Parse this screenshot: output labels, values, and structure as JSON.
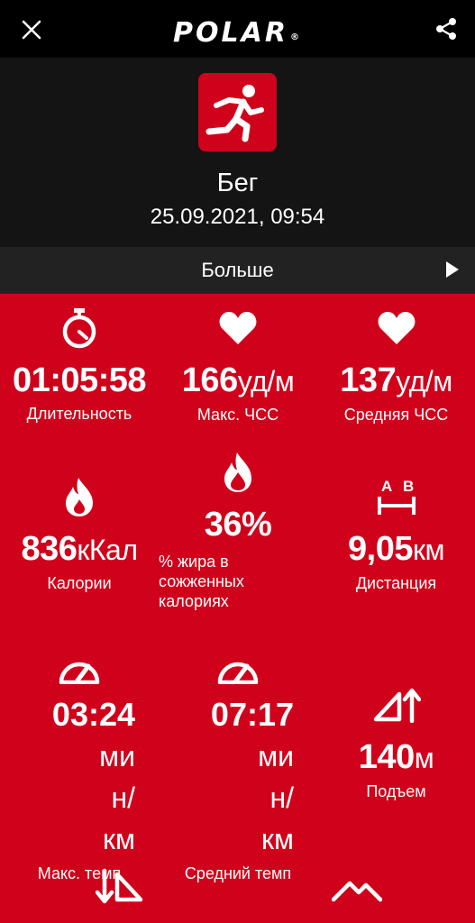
{
  "header": {
    "logo": "POLAR",
    "logo_mark": "®",
    "sport_name": "Бег",
    "date": "25.09.2021, 09:54",
    "more_label": "Больше"
  },
  "colors": {
    "accent": "#d0021b",
    "header_bg": "#141414",
    "topbar_bg": "#000000",
    "more_bar_bg": "#222222",
    "text": "#ffffff"
  },
  "stats": {
    "duration": {
      "icon": "stopwatch-icon",
      "value": "01:05:58",
      "label": "Длительность"
    },
    "max_hr": {
      "icon": "heart-icon",
      "value": "166",
      "unit": "уд/м",
      "label": "Макс. ЧСС"
    },
    "avg_hr": {
      "icon": "heart-icon",
      "value": "137",
      "unit": "уд/м",
      "label": "Средняя ЧСС"
    },
    "calories": {
      "icon": "flame-icon",
      "value": "836",
      "unit": "кКал",
      "label": "Калории"
    },
    "fat": {
      "icon": "flame-outline-icon",
      "value": "36%",
      "label_line1": "% жира в",
      "label_line2": "сожженных",
      "label_line3": "калориях"
    },
    "distance": {
      "icon": "distance-ab-icon",
      "value": "9,05",
      "unit": "км",
      "label": "Дистанция"
    },
    "max_pace": {
      "icon": "speedometer-icon",
      "value": "03:24",
      "unit_1": "ми",
      "unit_2": "н/",
      "unit_3": "км",
      "label": "Макс. темп"
    },
    "avg_pace": {
      "icon": "speedometer-icon",
      "value": "07:17",
      "unit_1": "ми",
      "unit_2": "н/",
      "unit_3": "км",
      "label": "Средний темп"
    },
    "ascent": {
      "icon": "ascent-icon",
      "value": "140",
      "unit": "м",
      "label": "Подъем"
    }
  },
  "bottom_icons": [
    "descent-icon",
    "mountains-icon"
  ]
}
